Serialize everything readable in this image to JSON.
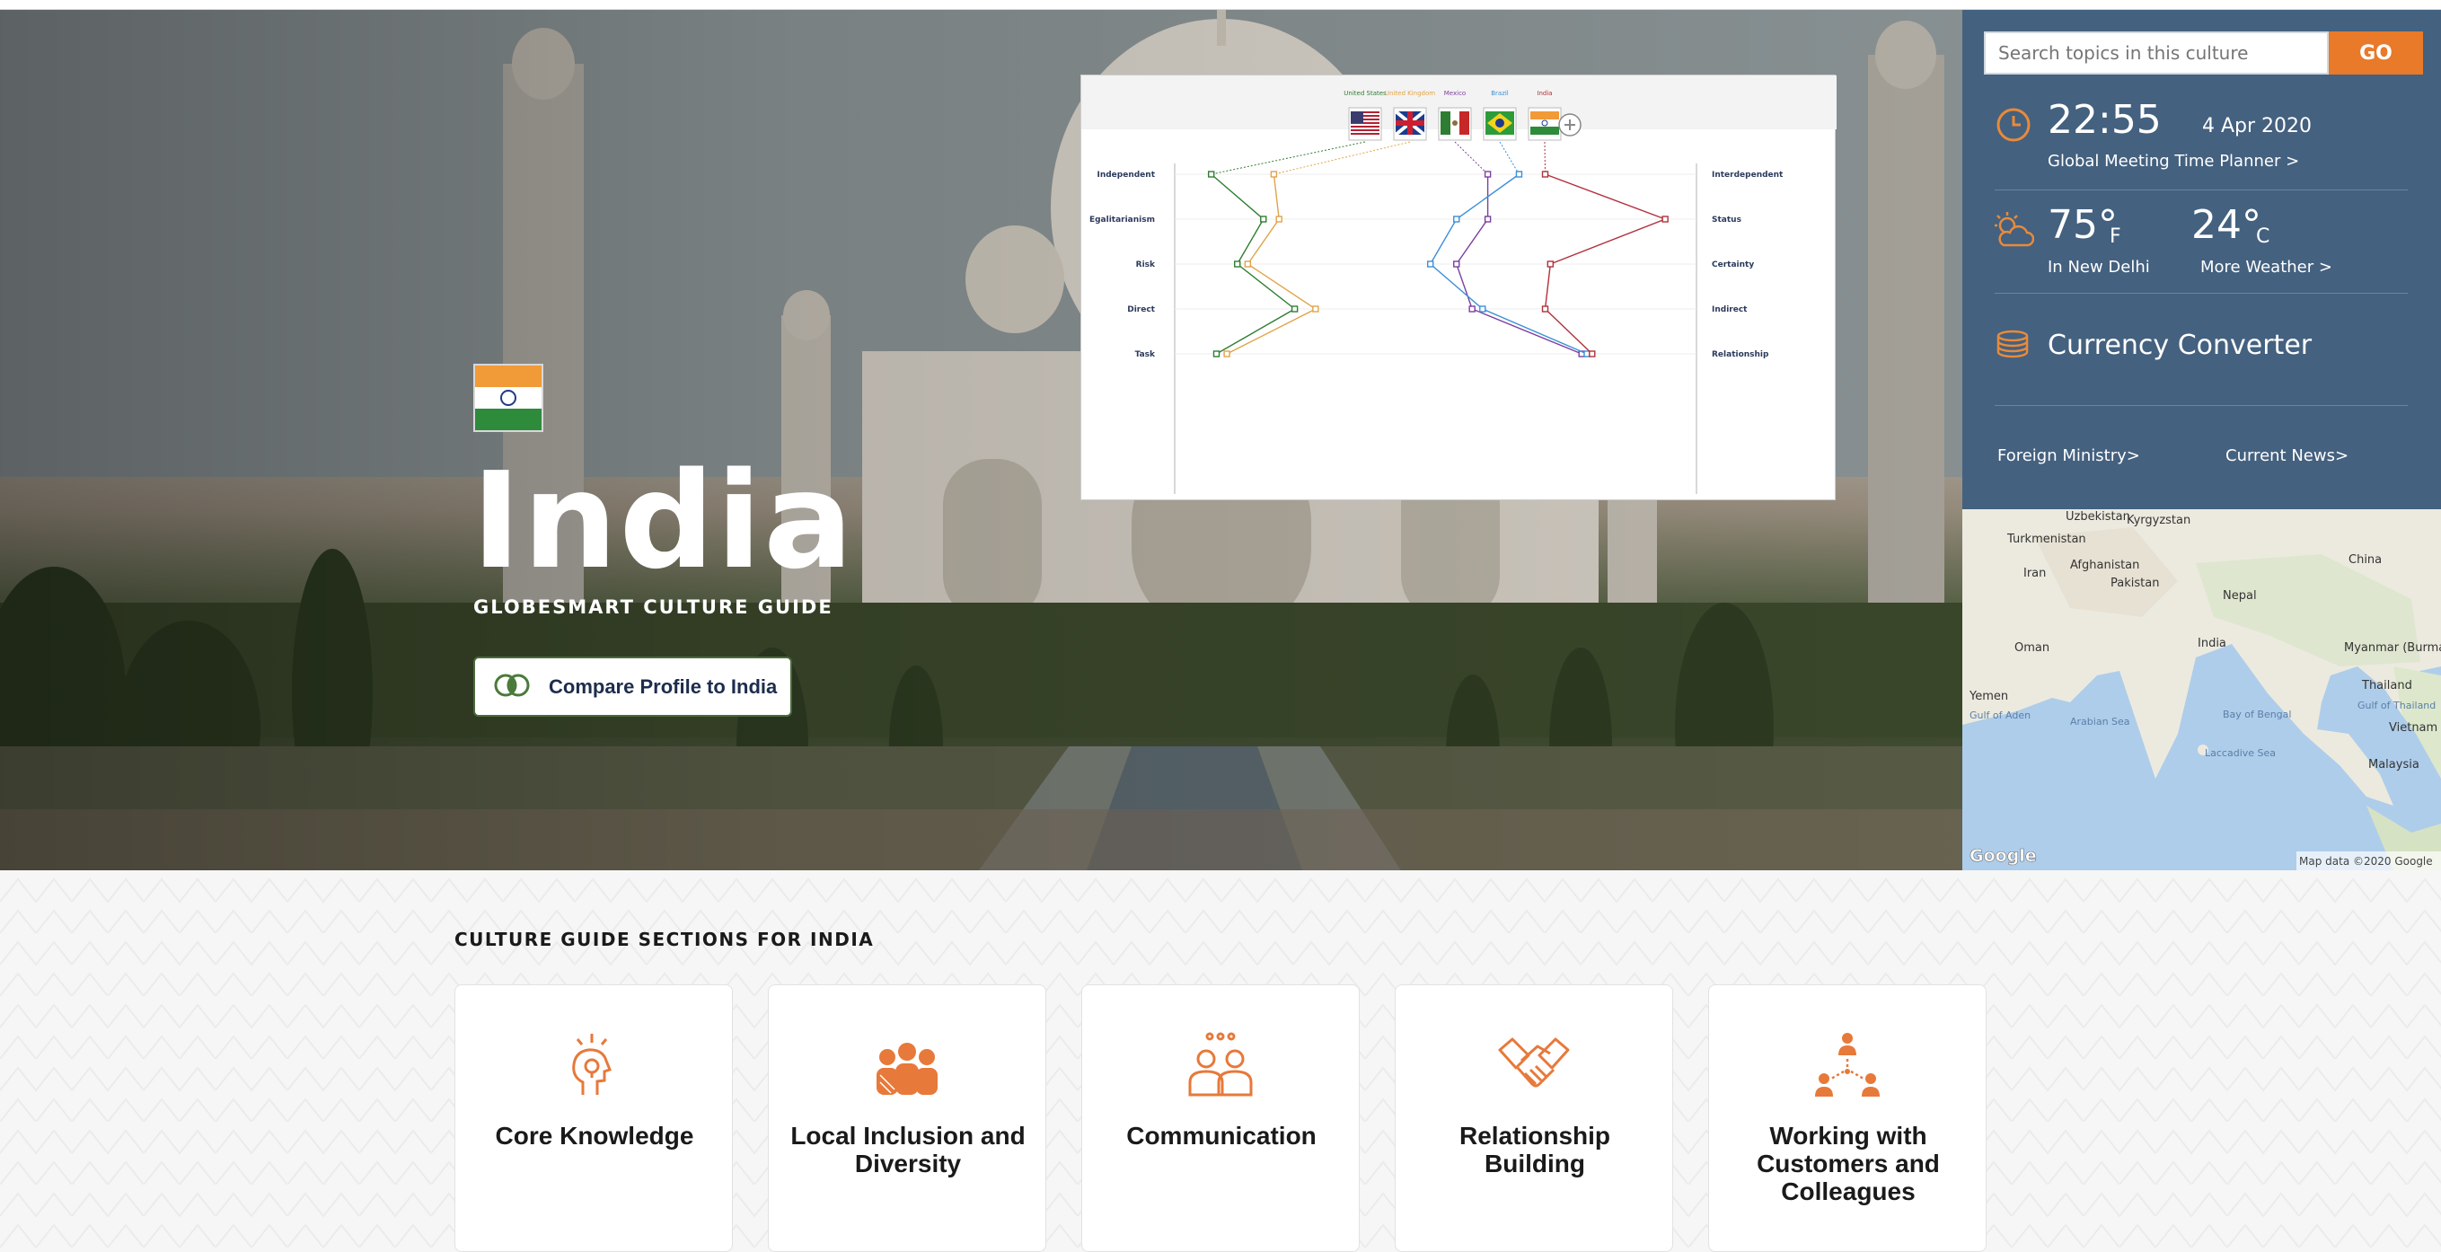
{
  "hero": {
    "country": "India",
    "subtitle": "GLOBESMART CULTURE GUIDE",
    "compare_label": "Compare Profile to India"
  },
  "chart": {
    "flags": [
      {
        "label": "United States",
        "color": "#2e7d32"
      },
      {
        "label": "United Kingdom",
        "color": "#e0a44a"
      },
      {
        "label": "Mexico",
        "color": "#7b3fa0"
      },
      {
        "label": "Brazil",
        "color": "#3b8fd9"
      },
      {
        "label": "India",
        "color": "#b0303a"
      }
    ],
    "left_labels": [
      "Independent",
      "Egalitarianism",
      "Risk",
      "Direct",
      "Task"
    ],
    "right_labels": [
      "Interdependent",
      "Status",
      "Certainty",
      "Indirect",
      "Relationship"
    ]
  },
  "chart_data": {
    "type": "line",
    "categories": [
      "Independent/Interdependent",
      "Egalitarianism/Status",
      "Risk/Certainty",
      "Direct/Indirect",
      "Task/Relationship"
    ],
    "series": [
      {
        "name": "United States",
        "values": [
          0.07,
          0.17,
          0.12,
          0.23,
          0.08
        ]
      },
      {
        "name": "United Kingdom",
        "values": [
          0.19,
          0.2,
          0.14,
          0.27,
          0.1
        ]
      },
      {
        "name": "Mexico",
        "values": [
          0.6,
          0.6,
          0.54,
          0.57,
          0.78
        ]
      },
      {
        "name": "Brazil",
        "values": [
          0.66,
          0.54,
          0.49,
          0.59,
          0.79
        ]
      },
      {
        "name": "India",
        "values": [
          0.71,
          0.94,
          0.72,
          0.71,
          0.8
        ]
      }
    ],
    "xlabel": "",
    "ylabel": ""
  },
  "sidebar": {
    "search_placeholder": "Search topics in this culture",
    "go_label": "GO",
    "time": "22:55",
    "date": "4 Apr 2020",
    "planner_link": "Global Meeting Time Planner >",
    "temp_f": "75°",
    "unit_f": "F",
    "temp_c": "24°",
    "unit_c": "C",
    "location": "In New Delhi",
    "more_weather": "More Weather >",
    "currency": "Currency Converter",
    "foreign_ministry": "Foreign Ministry>",
    "current_news": "Current News>"
  },
  "map": {
    "labels": [
      "Uzbekistan",
      "Kyrgyzstan",
      "Turkmenistan",
      "Afghanistan",
      "Iran",
      "Pakistan",
      "China",
      "Nepal",
      "India",
      "Oman",
      "Myanmar (Burma)",
      "Yemen",
      "Thailand",
      "Gulf of Aden",
      "Arabian Sea",
      "Bay of Bengal",
      "Gulf of Thailand",
      "Vietnam",
      "Laccadive Sea",
      "Malaysia"
    ],
    "brand": "Google",
    "attribution": "Map data ©2020 Google"
  },
  "sections": {
    "title": "CULTURE GUIDE SECTIONS FOR INDIA",
    "cards": [
      {
        "label": "Core Knowledge",
        "icon": "head-bulb-icon"
      },
      {
        "label": "Local Inclusion and Diversity",
        "icon": "diverse-people-icon"
      },
      {
        "label": "Communication",
        "icon": "group-talk-icon"
      },
      {
        "label": "Relationship Building",
        "icon": "handshake-icon"
      },
      {
        "label": "Working with Customers and Colleagues",
        "icon": "network-people-icon"
      }
    ]
  }
}
